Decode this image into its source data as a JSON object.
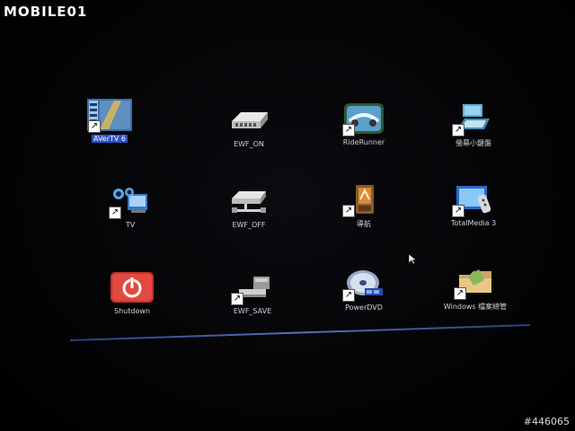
{
  "watermark": {
    "text": "MOBILE01"
  },
  "photo_id": "#446065",
  "desktop": {
    "icons": [
      {
        "label": "AVerTV 6",
        "icon": "avertv-icon",
        "selected": true
      },
      {
        "label": "EWF_ON",
        "icon": "ewf-on-icon",
        "selected": false
      },
      {
        "label": "RideRunner",
        "icon": "riderunner-icon",
        "selected": false
      },
      {
        "label": "螢幕小鍵盤",
        "icon": "on-screen-keyboard-icon",
        "selected": false
      },
      {
        "label": "TV",
        "icon": "tv-icon",
        "selected": false
      },
      {
        "label": "EWF_OFF",
        "icon": "ewf-off-icon",
        "selected": false
      },
      {
        "label": "導航",
        "icon": "navigation-icon",
        "selected": false
      },
      {
        "label": "TotalMedia 3",
        "icon": "totalmedia-icon",
        "selected": false
      },
      {
        "label": "Shutdown",
        "icon": "shutdown-icon",
        "selected": false
      },
      {
        "label": "EWF_SAVE",
        "icon": "ewf-save-icon",
        "selected": false
      },
      {
        "label": "PowerDVD",
        "icon": "powerdvd-icon",
        "selected": false
      },
      {
        "label": "Windows 檔案總管",
        "icon": "windows-explorer-icon",
        "selected": false
      }
    ]
  },
  "colors": {
    "selection": "#2a52c8",
    "label": "#d0d0d8",
    "shutdown_red": "#c8302a"
  }
}
